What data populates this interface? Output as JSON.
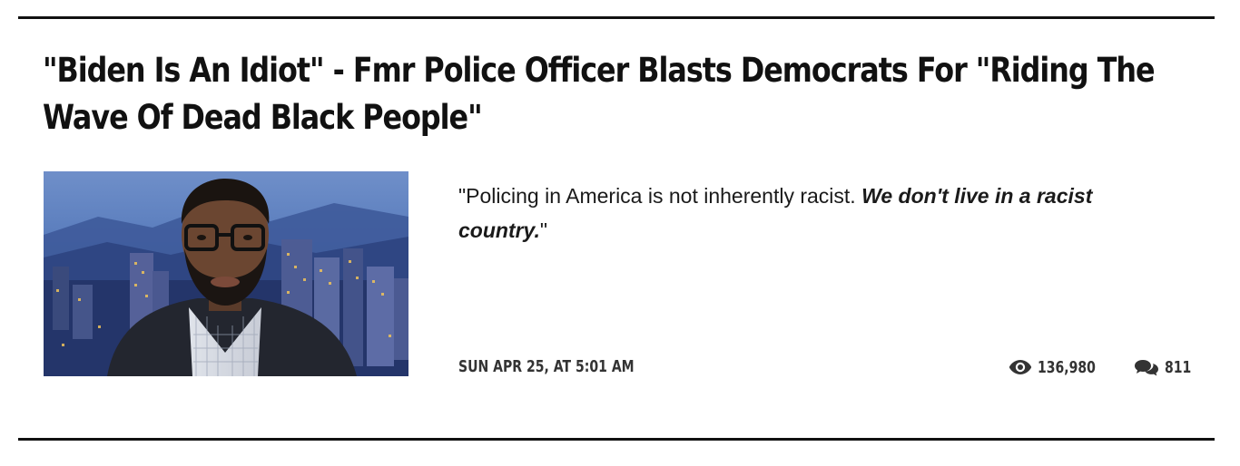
{
  "article": {
    "headline": "\"Biden Is An Idiot\" - Fmr Police Officer Blasts Democrats For \"Riding The Wave Of Dead Black People\"",
    "excerpt": {
      "lead": "\"Policing in America is not inherently racist. ",
      "emphasis": "We don't live in a racist country.",
      "tail": "\""
    },
    "date": "SUN APR 25, AT 5:01 AM",
    "views": "136,980",
    "comments": "811",
    "icons": {
      "views": "eye-icon",
      "comments": "comments-icon"
    }
  },
  "colors": {
    "text": "#111111",
    "meta": "#333333",
    "rule": "#111111",
    "background": "#ffffff"
  }
}
